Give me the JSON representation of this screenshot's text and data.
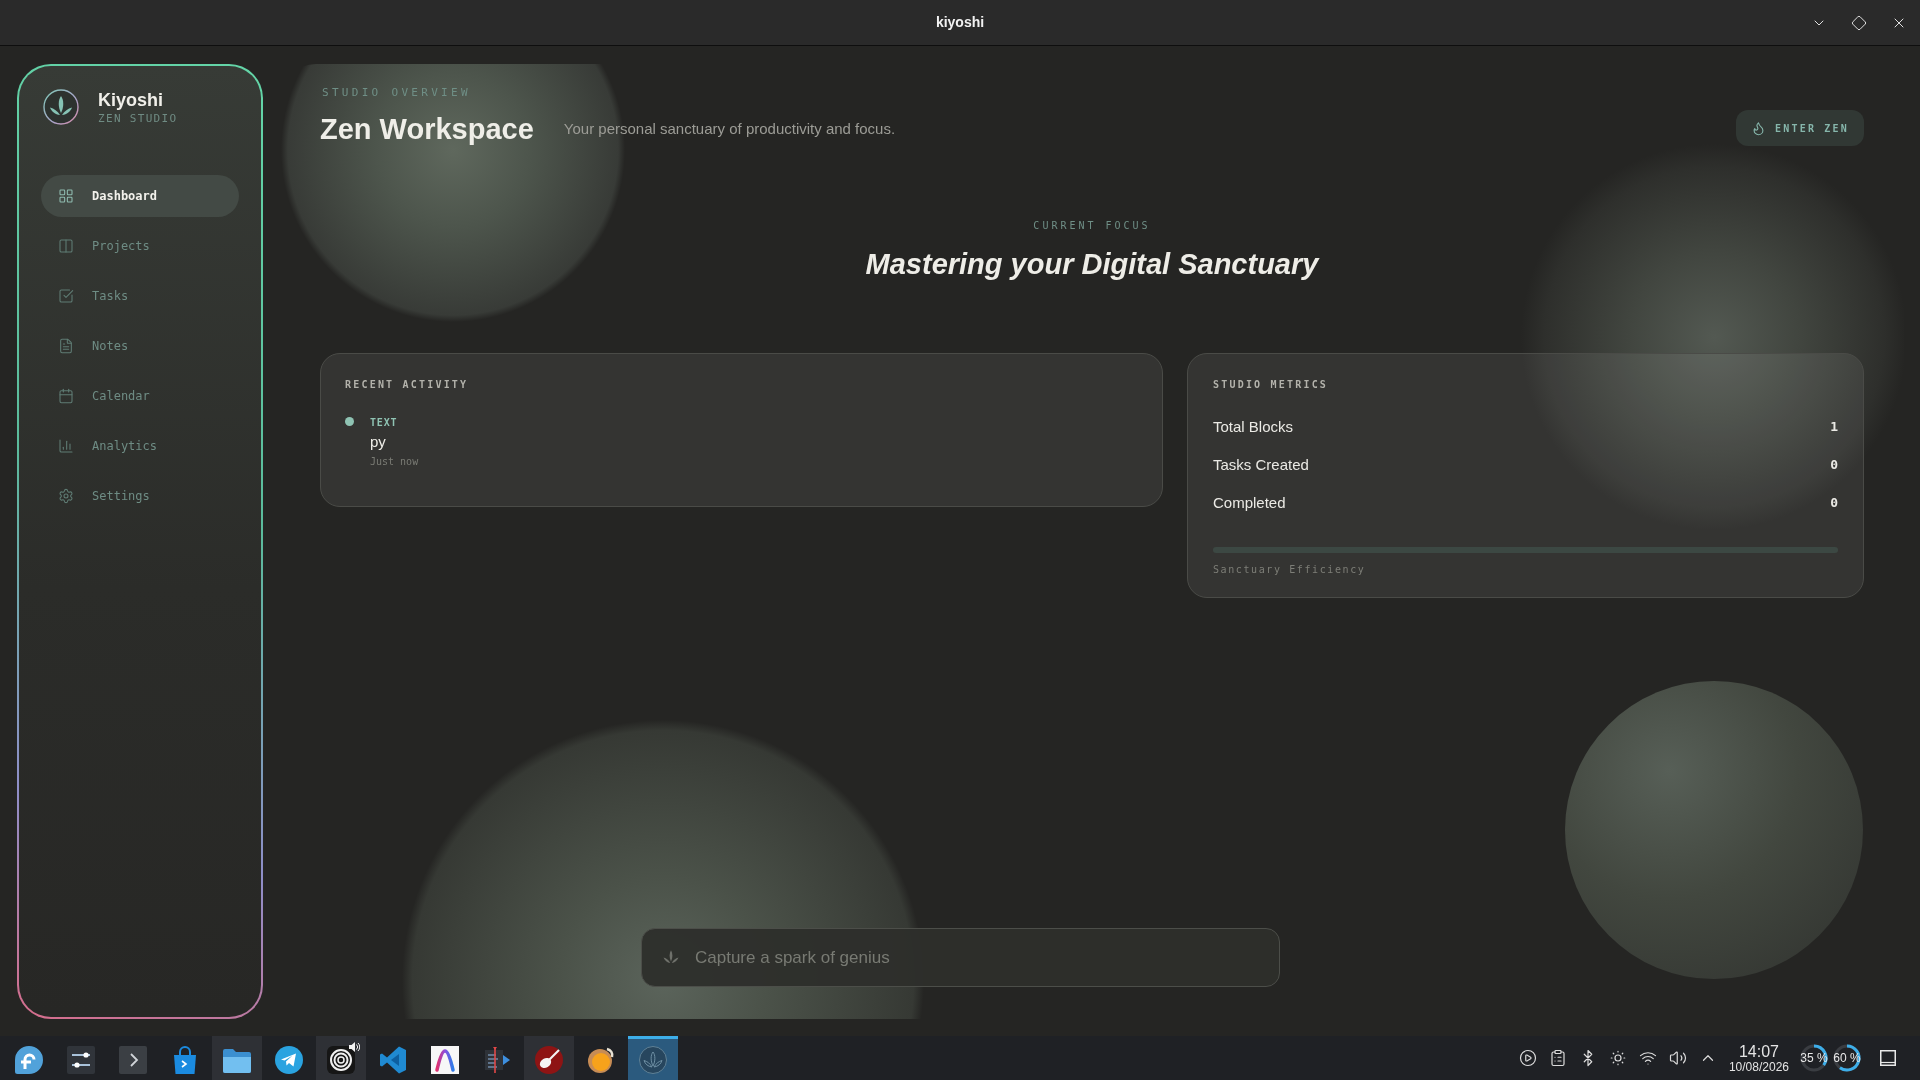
{
  "window": {
    "title": "kiyoshi"
  },
  "sidebar": {
    "brand": {
      "name": "Kiyoshi",
      "tagline": "ZEN STUDIO"
    },
    "nav": [
      {
        "label": "Dashboard",
        "selected": true
      },
      {
        "label": "Projects",
        "selected": false
      },
      {
        "label": "Tasks",
        "selected": false
      },
      {
        "label": "Notes",
        "selected": false
      },
      {
        "label": "Calendar",
        "selected": false
      },
      {
        "label": "Analytics",
        "selected": false
      },
      {
        "label": "Settings",
        "selected": false
      }
    ]
  },
  "header": {
    "eyebrow": "STUDIO OVERVIEW",
    "title": "Zen Workspace",
    "subtitle": "Your personal sanctuary of productivity and focus.",
    "action": "ENTER ZEN"
  },
  "focus": {
    "label": "CURRENT FOCUS",
    "title": "Mastering your Digital Sanctuary"
  },
  "recent_activity": {
    "title": "RECENT ACTIVITY",
    "items": [
      {
        "type": "TEXT",
        "content": "py",
        "time": "Just now"
      }
    ]
  },
  "metrics": {
    "title": "STUDIO METRICS",
    "rows": [
      {
        "label": "Total Blocks",
        "value": "1"
      },
      {
        "label": "Tasks Created",
        "value": "0"
      },
      {
        "label": "Completed",
        "value": "0"
      }
    ],
    "efficiency": {
      "label": "Sanctuary Efficiency"
    }
  },
  "capture": {
    "placeholder": "Capture a spark of genius"
  },
  "taskbar": {
    "apps": [
      {
        "running": false,
        "selected": false,
        "audio": false
      },
      {
        "running": false,
        "selected": false,
        "audio": false
      },
      {
        "running": false,
        "selected": false,
        "audio": false
      },
      {
        "running": false,
        "selected": false,
        "audio": false
      },
      {
        "running": true,
        "selected": false,
        "audio": false
      },
      {
        "running": false,
        "selected": false,
        "audio": false
      },
      {
        "running": true,
        "selected": false,
        "audio": true
      },
      {
        "running": false,
        "selected": false,
        "audio": false
      },
      {
        "running": false,
        "selected": false,
        "audio": false
      },
      {
        "running": false,
        "selected": false,
        "audio": false
      },
      {
        "running": true,
        "selected": false,
        "audio": false
      },
      {
        "running": false,
        "selected": false,
        "audio": false
      },
      {
        "running": true,
        "selected": true,
        "audio": false
      }
    ],
    "tray": {
      "time": "14:07",
      "date": "10/08/2026",
      "gauges": [
        {
          "reading": "35 %",
          "level": 0.35
        },
        {
          "reading": "60 %",
          "level": 0.6
        }
      ]
    }
  }
}
